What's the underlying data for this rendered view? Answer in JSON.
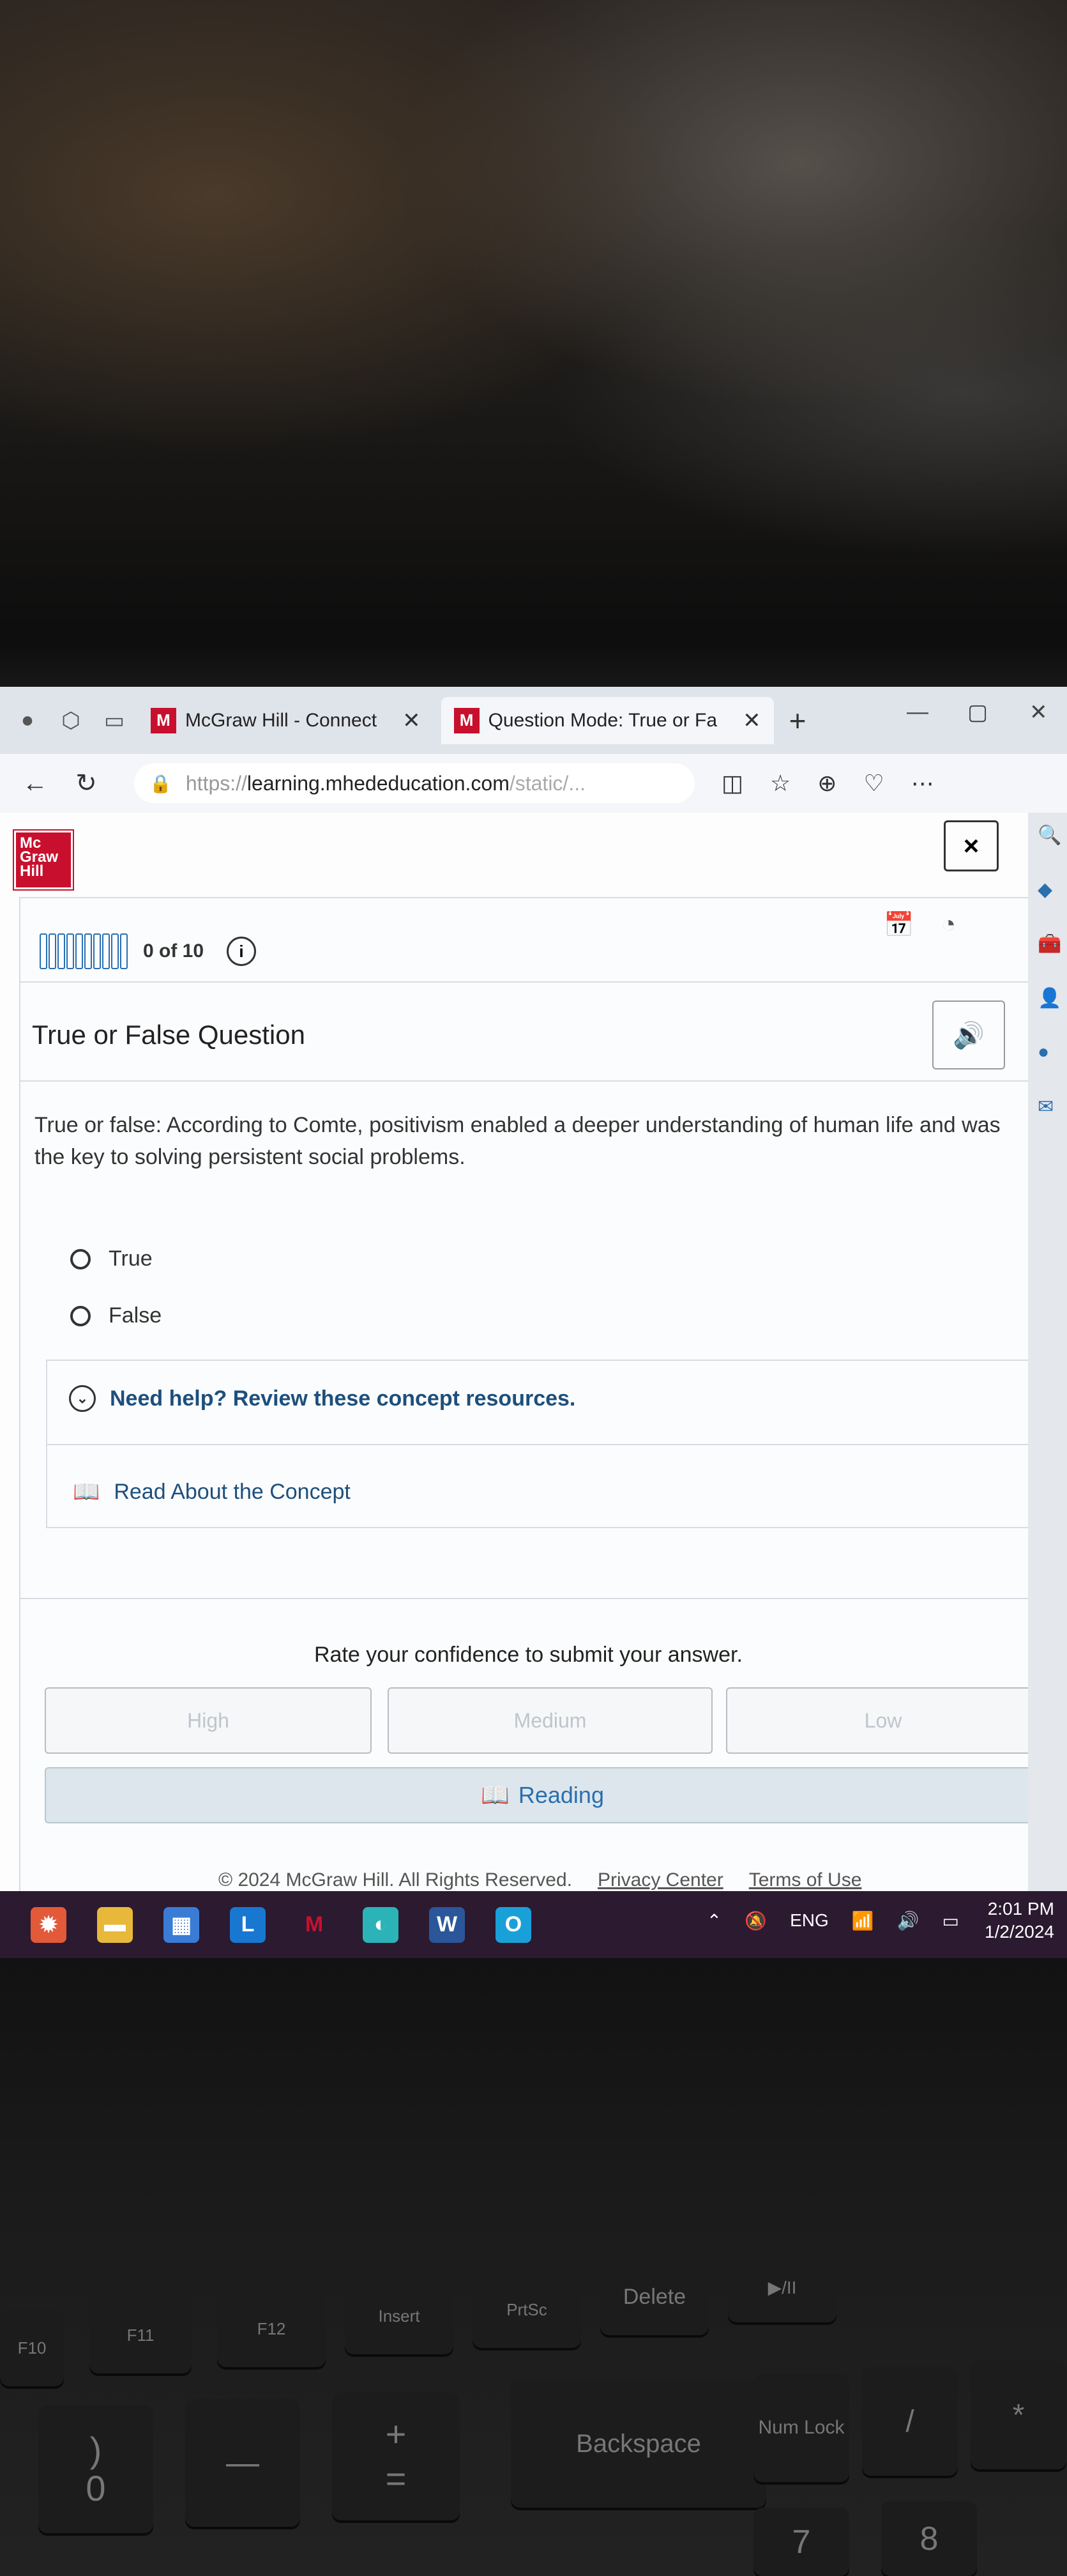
{
  "browser": {
    "tabs": [
      {
        "label": "McGraw Hill - Connect",
        "badge": "M"
      },
      {
        "label": "Question Mode: True or Fa",
        "badge": "M"
      }
    ],
    "new_tab": "+",
    "url_scheme": "https://",
    "url_domain": "learning.mhededucation.com",
    "url_path": "/static/..."
  },
  "logo": {
    "line1": "Mc",
    "line2": "Graw",
    "line3": "Hill"
  },
  "close_label": "×",
  "progress": {
    "text": "0 of 10",
    "answered": 0,
    "total": 10
  },
  "question": {
    "type_title": "True or False Question",
    "text": "True or false: According to Comte, positivism enabled a deeper understanding of human life and was the key to solving persistent social problems.",
    "options": [
      "True",
      "False"
    ]
  },
  "help": {
    "heading": "Need help? Review these concept resources.",
    "link": "Read About the Concept"
  },
  "confidence": {
    "label": "Rate your confidence to submit your answer.",
    "high": "High",
    "medium": "Medium",
    "low": "Low"
  },
  "reading_label": "Reading",
  "footer": {
    "copyright": "© 2024 McGraw Hill. All Rights Reserved.",
    "privacy": "Privacy Center",
    "terms": "Terms of Use"
  },
  "taskbar": {
    "lang": "ENG",
    "time": "2:01 PM",
    "date": "1/2/2024",
    "app_l": "L",
    "app_w": "W"
  },
  "keyboard": {
    "f10": "F10",
    "f11": "F11",
    "f12": "F12",
    "insert": "Insert",
    "prtsc": "PrtSc",
    "delete": "Delete",
    "playpause": "▶/II",
    "backspace": "Backspace",
    "numlock": "Num Lock",
    "k0": "0",
    "paren": ")",
    "minus": "—",
    "plus": "+",
    "equals": "=",
    "slash": "/",
    "star": "*",
    "k7": "7",
    "k8": "8"
  },
  "colors": {
    "brand": "#c8102e",
    "link": "#1d4f7c",
    "accent": "#2a6fb0"
  }
}
